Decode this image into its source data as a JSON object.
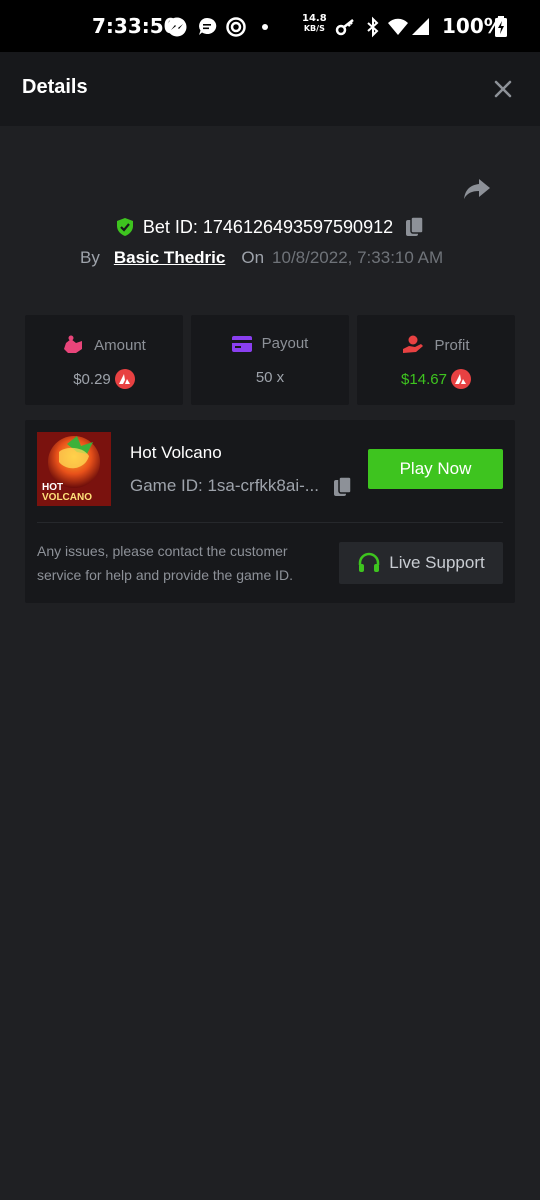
{
  "status_bar": {
    "time": "7:33:50",
    "speed_value": "14.8",
    "speed_unit": "KB/S",
    "battery": "100%"
  },
  "header": {
    "title": "Details"
  },
  "bet": {
    "id_label": "Bet ID: 1746126493597590912",
    "by_label": "By",
    "user": "Basic Thedric",
    "on_label": "On",
    "date": "10/8/2022, 7:33:10 AM"
  },
  "stats": {
    "amount": {
      "label": "Amount",
      "value": "$0.29"
    },
    "payout": {
      "label": "Payout",
      "value": "50 x"
    },
    "profit": {
      "label": "Profit",
      "value": "$14.67"
    }
  },
  "game": {
    "name": "Hot Volcano",
    "id_text": "Game ID: 1sa-crfkk8ai-...",
    "thumb_text_line1": "HOT",
    "thumb_text_line2": "VOLCANO",
    "play_label": "Play Now",
    "issue_text": "Any issues, please contact the customer service for help and provide the game ID.",
    "support_label": "Live Support"
  },
  "colors": {
    "accent_green": "#3ec41f",
    "profit_green": "#3ec41f",
    "coin_red": "#e84142",
    "background": "#1f2023",
    "card": "#17181b"
  }
}
